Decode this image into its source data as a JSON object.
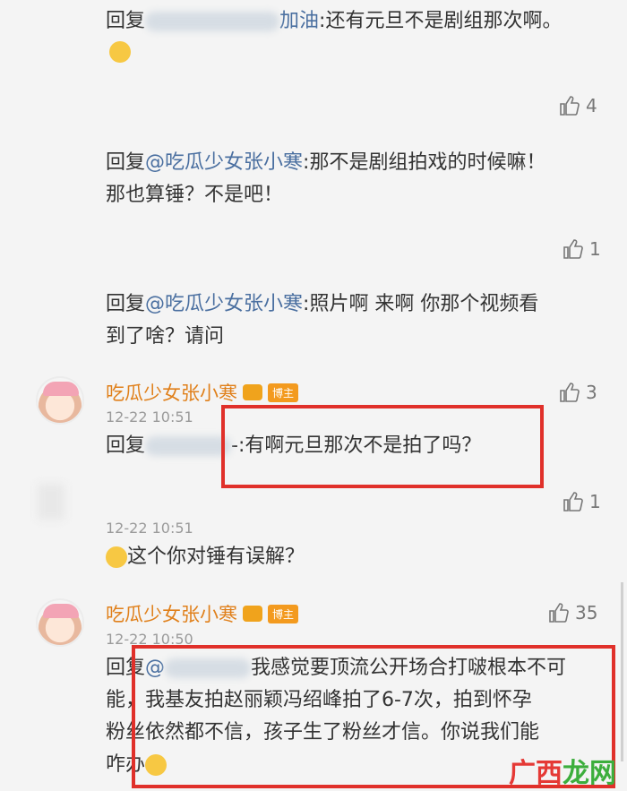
{
  "comments": [
    {
      "reply_prefix": "回复",
      "mention_suffix": "加油",
      "text": ":还有元旦不是剧组那次啊。",
      "like_count": "4",
      "emoji": "doge-emoji"
    },
    {
      "reply_prefix": "回复",
      "mention": "@吃瓜少女张小寒",
      "text_line1": ":那不是剧组拍戏的时候嘛！",
      "text_line2": "那也算锤？不是吧！",
      "like_count": "1"
    },
    {
      "reply_prefix": "回复",
      "mention": "@吃瓜少女张小寒",
      "text_line1": ":照片啊 来啊 你那个视频看",
      "text_line2": "到了啥？请问",
      "like_count": "3"
    },
    {
      "username": "吃瓜少女张小寒",
      "host_badge": "博主",
      "time": "12-22 10:51",
      "reply_prefix": "回复",
      "mention_suffix": "-",
      "text": ":有啊元旦那次不是拍了吗？",
      "like_count": "1"
    },
    {
      "time": "12-22 10:51",
      "text": "这个你对锤有误解？",
      "emoji": "laugh-cry-emoji"
    },
    {
      "username": "吃瓜少女张小寒",
      "host_badge": "博主",
      "time": "12-22 10:50",
      "like_count": "35",
      "reply_prefix": "回复",
      "text_line1": "我感觉要顶流公开场合打啵根本不可",
      "text_line2": "能，我基友拍赵丽颖冯绍峰拍了6-7次，拍到怀孕",
      "text_line3": "粉丝依然都不信，孩子生了粉丝才信。你说我们能",
      "text_line4": "咋办"
    }
  ],
  "watermark": {
    "part1": "广西",
    "part2": "龙网"
  },
  "colors": {
    "accent_red": "#e0302a",
    "link_blue": "#4a6fa0",
    "username_orange": "#e0801b"
  }
}
